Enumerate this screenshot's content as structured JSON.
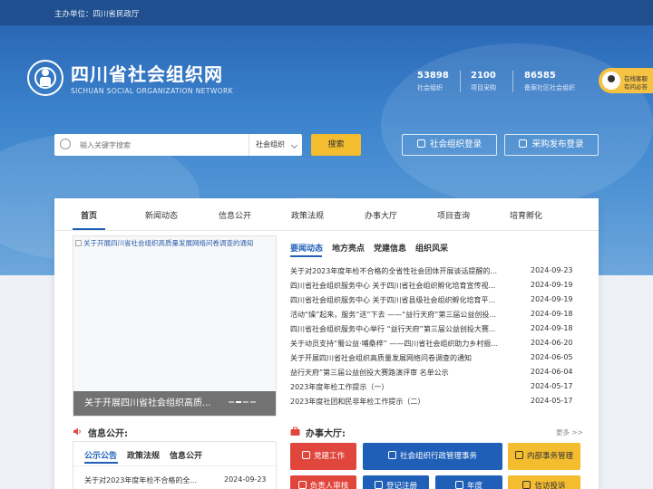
{
  "topbar": {
    "sponsor": "主办单位：四川省民政厅"
  },
  "brand": {
    "title": "四川省社会组织网",
    "subtitle": "SICHUAN SOCIAL ORGANIZATION NETWORK"
  },
  "stats": [
    {
      "value": "53898",
      "label": "社会组织"
    },
    {
      "value": "2100",
      "label": "项目采购"
    },
    {
      "value": "86585",
      "label": "备案社区社会组织"
    }
  ],
  "service": {
    "line1": "在线客服",
    "line2": "有问必答"
  },
  "search": {
    "placeholder": "输入关键字搜索",
    "category": "社会组织",
    "button": "搜索"
  },
  "auth": {
    "org_login": "社会组织登录",
    "purchase_login": "采购发布登录"
  },
  "nav": {
    "items": [
      "首页",
      "新闻动态",
      "信息公开",
      "政策法规",
      "办事大厅",
      "项目查询",
      "培育孵化"
    ],
    "active": "首页"
  },
  "slider": {
    "image_alt": "关于开展四川省社会组织高质量发展网络问卷调查的通知",
    "caption": "关于开展四川省社会组织高质..."
  },
  "news": {
    "tabs": [
      "要闻动态",
      "地方亮点",
      "党建信息",
      "组织风采"
    ],
    "active_tab": "要闻动态",
    "items": [
      {
        "title": "关于对2023年度年检不合格的全省性社会团体开展谈话提醒的...",
        "date": "2024-09-23"
      },
      {
        "title": "四川省社会组织服务中心 关于四川省社会组织孵化培育宣传视...",
        "date": "2024-09-19"
      },
      {
        "title": "四川省社会组织服务中心 关于四川省县级社会组织孵化培育平...",
        "date": "2024-09-19"
      },
      {
        "title": "活动“燥”起来，服务“送”下去 ——“益行天府”第三届公益创投...",
        "date": "2024-09-18"
      },
      {
        "title": "四川省社会组织服务中心举行 “益行天府”第三届公益创投大赛...",
        "date": "2024-09-18"
      },
      {
        "title": "关于动员支持“蜀公益·哺桑梓” ——四川省社会组织助力乡村振...",
        "date": "2024-06-20"
      },
      {
        "title": "关于开展四川省社会组织高质量发展网络问卷调查的通知",
        "date": "2024-06-05"
      },
      {
        "title": "益行天府”第三届公益创投大赛路演评审 名单公示",
        "date": "2024-06-04"
      },
      {
        "title": "2023年度年检工作提示（一）",
        "date": "2024-05-17"
      },
      {
        "title": "2023年度社团和民非年检工作提示（二）",
        "date": "2024-05-17"
      }
    ]
  },
  "info_public": {
    "heading": "信息公开:",
    "tabs": [
      "公示公告",
      "政策法规",
      "信息公开"
    ],
    "active_tab": "公示公告",
    "items": [
      {
        "title": "关于对2023年度年检不合格的全...",
        "date": "2024-09-23"
      }
    ]
  },
  "hall": {
    "heading": "办事大厅:",
    "more": "更多 >>",
    "buttons": [
      {
        "label": "党建工作",
        "color": "#e0463c"
      },
      {
        "label": "社会组织行政管理事务",
        "color": "#1f5fb8"
      },
      {
        "label": "内部事务管理",
        "color": "#f4bc2f"
      }
    ],
    "second_row": [
      {
        "label": "负责人审核",
        "color": "#e0463c"
      },
      {
        "label": "登记注册",
        "color": "#1f5fb8"
      },
      {
        "label": "年度",
        "color": "#1f5fb8"
      },
      {
        "label": "信访投诉",
        "color": "#f4bc2f"
      }
    ]
  },
  "colors": {
    "topbar": "#1f4f8e",
    "primary": "#1f5fb8",
    "accent": "#f4bc2f",
    "red": "#e0463c"
  }
}
